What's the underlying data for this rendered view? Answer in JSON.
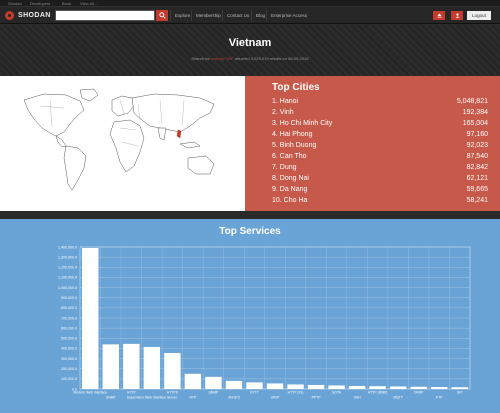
{
  "topbar": {
    "links": [
      "Shodan",
      "Developers",
      "Book",
      "View All..."
    ]
  },
  "navbar": {
    "brand": "SHODAN",
    "search_placeholder": "",
    "links": [
      "Explore",
      "Membership",
      "Contact Us",
      "Blog",
      "Enterprise Access"
    ],
    "logout_label": "Logout",
    "icons": [
      "upload-icon",
      "user-icon",
      "search-icon"
    ]
  },
  "hero": {
    "title": "Vietnam",
    "subtitle_prefix": "Search for",
    "subtitle_query": "country:\"VN\"",
    "subtitle_suffix": "returned 3,229,019 results on 06-09-2015"
  },
  "top_cities": {
    "title": "Top Cities",
    "items": [
      {
        "label": "1. Hanoi",
        "count": "5,048,821"
      },
      {
        "label": "2. Vinh",
        "count": "192,384"
      },
      {
        "label": "3. Ho Chi Minh City",
        "count": "165,004"
      },
      {
        "label": "4. Hai Phong",
        "count": "97,160"
      },
      {
        "label": "5. Binh Duong",
        "count": "92,023"
      },
      {
        "label": "6. Can Tho",
        "count": "87,540"
      },
      {
        "label": "7. Dung",
        "count": "82,842"
      },
      {
        "label": "8. Dong Nai",
        "count": "62,121"
      },
      {
        "label": "9. Da Nang",
        "count": "59,665"
      },
      {
        "label": "10. Cho Ha",
        "count": "58,241"
      }
    ]
  },
  "colors": {
    "accent": "#c43a2c",
    "cities_bg": "#c7594b",
    "services_bg": "#6aa3d5"
  },
  "chart_data": {
    "type": "bar",
    "title": "Top Services",
    "ylim": [
      0,
      1400000
    ],
    "y_ticks": [
      "0.0",
      "100,000.0",
      "200,000.0",
      "300,000.0",
      "400,000.0",
      "500,000.0",
      "600,000.0",
      "700,000.0",
      "800,000.0",
      "900,000.0",
      "1,000,000.0",
      "1,100,000.0",
      "1,200,000.0",
      "1,300,000.0",
      "1,400,000.0"
    ],
    "grid": true,
    "categories": [
      "Modern Web Interface",
      "SNMP",
      "HTTP",
      "Supermicro Web Interface Server",
      "HTTPS",
      "NTP",
      "SNMP",
      "AH-573",
      "GTTT",
      "UPnP",
      "HTTP (91)",
      "PPTP",
      "SOTA",
      "SSH",
      "HTTP (8080)",
      "MQTT",
      "DNSP",
      "FTP",
      "SIP"
    ],
    "values": [
      1390000,
      440000,
      445000,
      415000,
      355000,
      150000,
      120000,
      80000,
      65000,
      55000,
      45000,
      40000,
      35000,
      30000,
      28000,
      25000,
      22000,
      20000,
      17000
    ]
  }
}
